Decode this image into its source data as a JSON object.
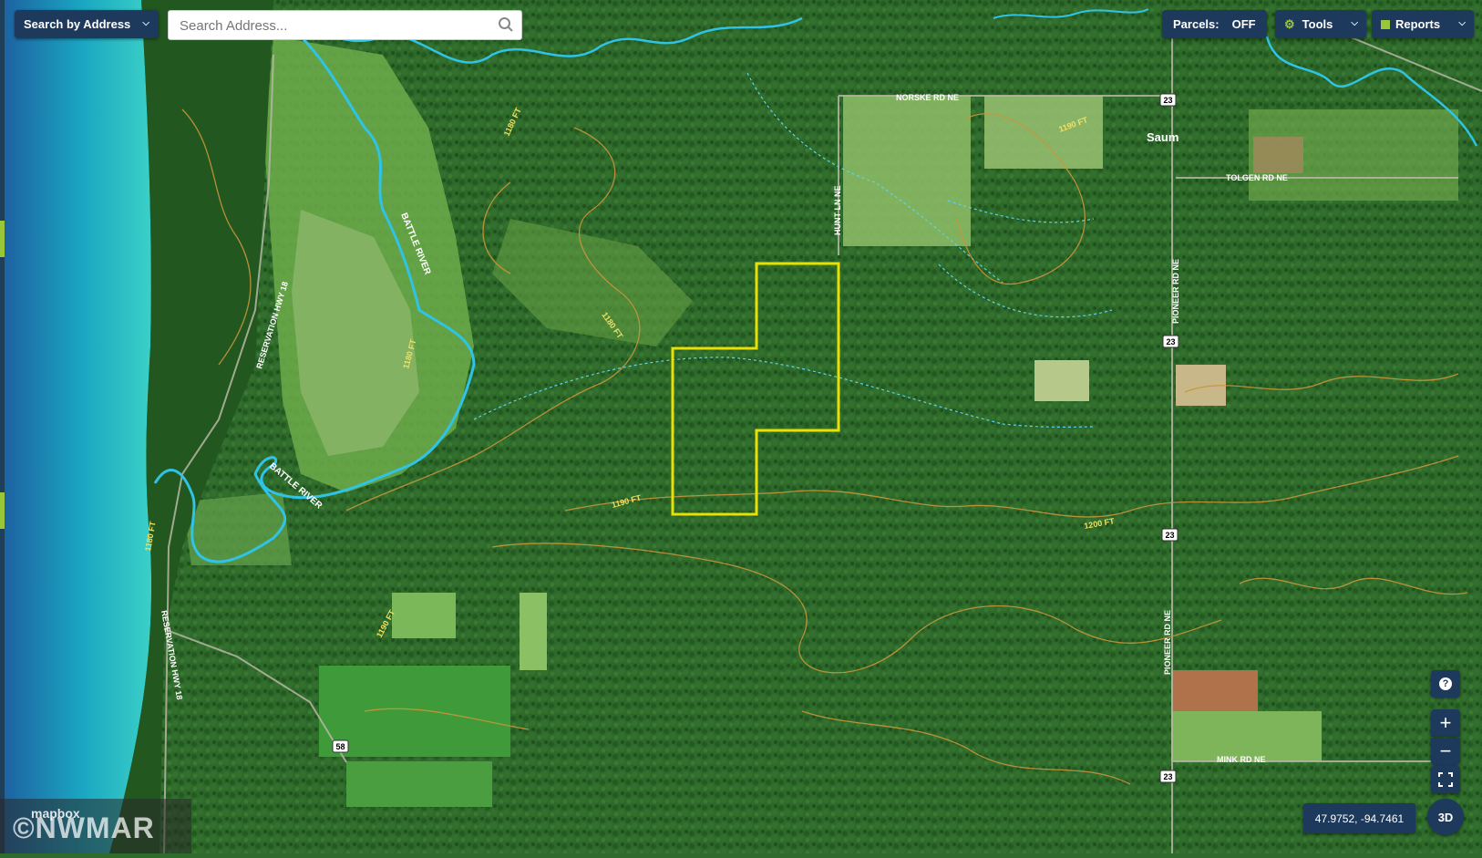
{
  "header": {
    "search_mode_label": "Search by Address",
    "search_placeholder": "Search Address...",
    "parcels_label": "Parcels:",
    "parcels_state": "OFF",
    "tools_label": "Tools",
    "reports_label": "Reports"
  },
  "controls": {
    "help_icon": "question-icon",
    "zoom_in_label": "+",
    "zoom_out_label": "−",
    "fullscreen_icon": "fullscreen-icon",
    "three_d_label": "3D",
    "coordinates": "47.9752, -94.7461"
  },
  "attribution": {
    "mapbox": "mapbox",
    "watermark": "©NWMAR"
  },
  "map": {
    "places": [
      "Saum"
    ],
    "roads": [
      "NORSKE RD NE",
      "TOLGEN RD NE",
      "HUNT LN NE",
      "PIONEER RD NE",
      "MINK RD NE",
      "RESERVATION HWY 18"
    ],
    "rivers": [
      "BATTLE RIVER"
    ],
    "route_shields": [
      "23",
      "58"
    ],
    "contours": [
      "1180 FT",
      "1190 FT",
      "1200 FT"
    ],
    "colors": {
      "parcel_outline": "#e8e000",
      "river": "#2fc3e6",
      "contour": "#c9963a",
      "lake": "#1eb6c4",
      "control_bg": "#1d3a5c"
    }
  }
}
